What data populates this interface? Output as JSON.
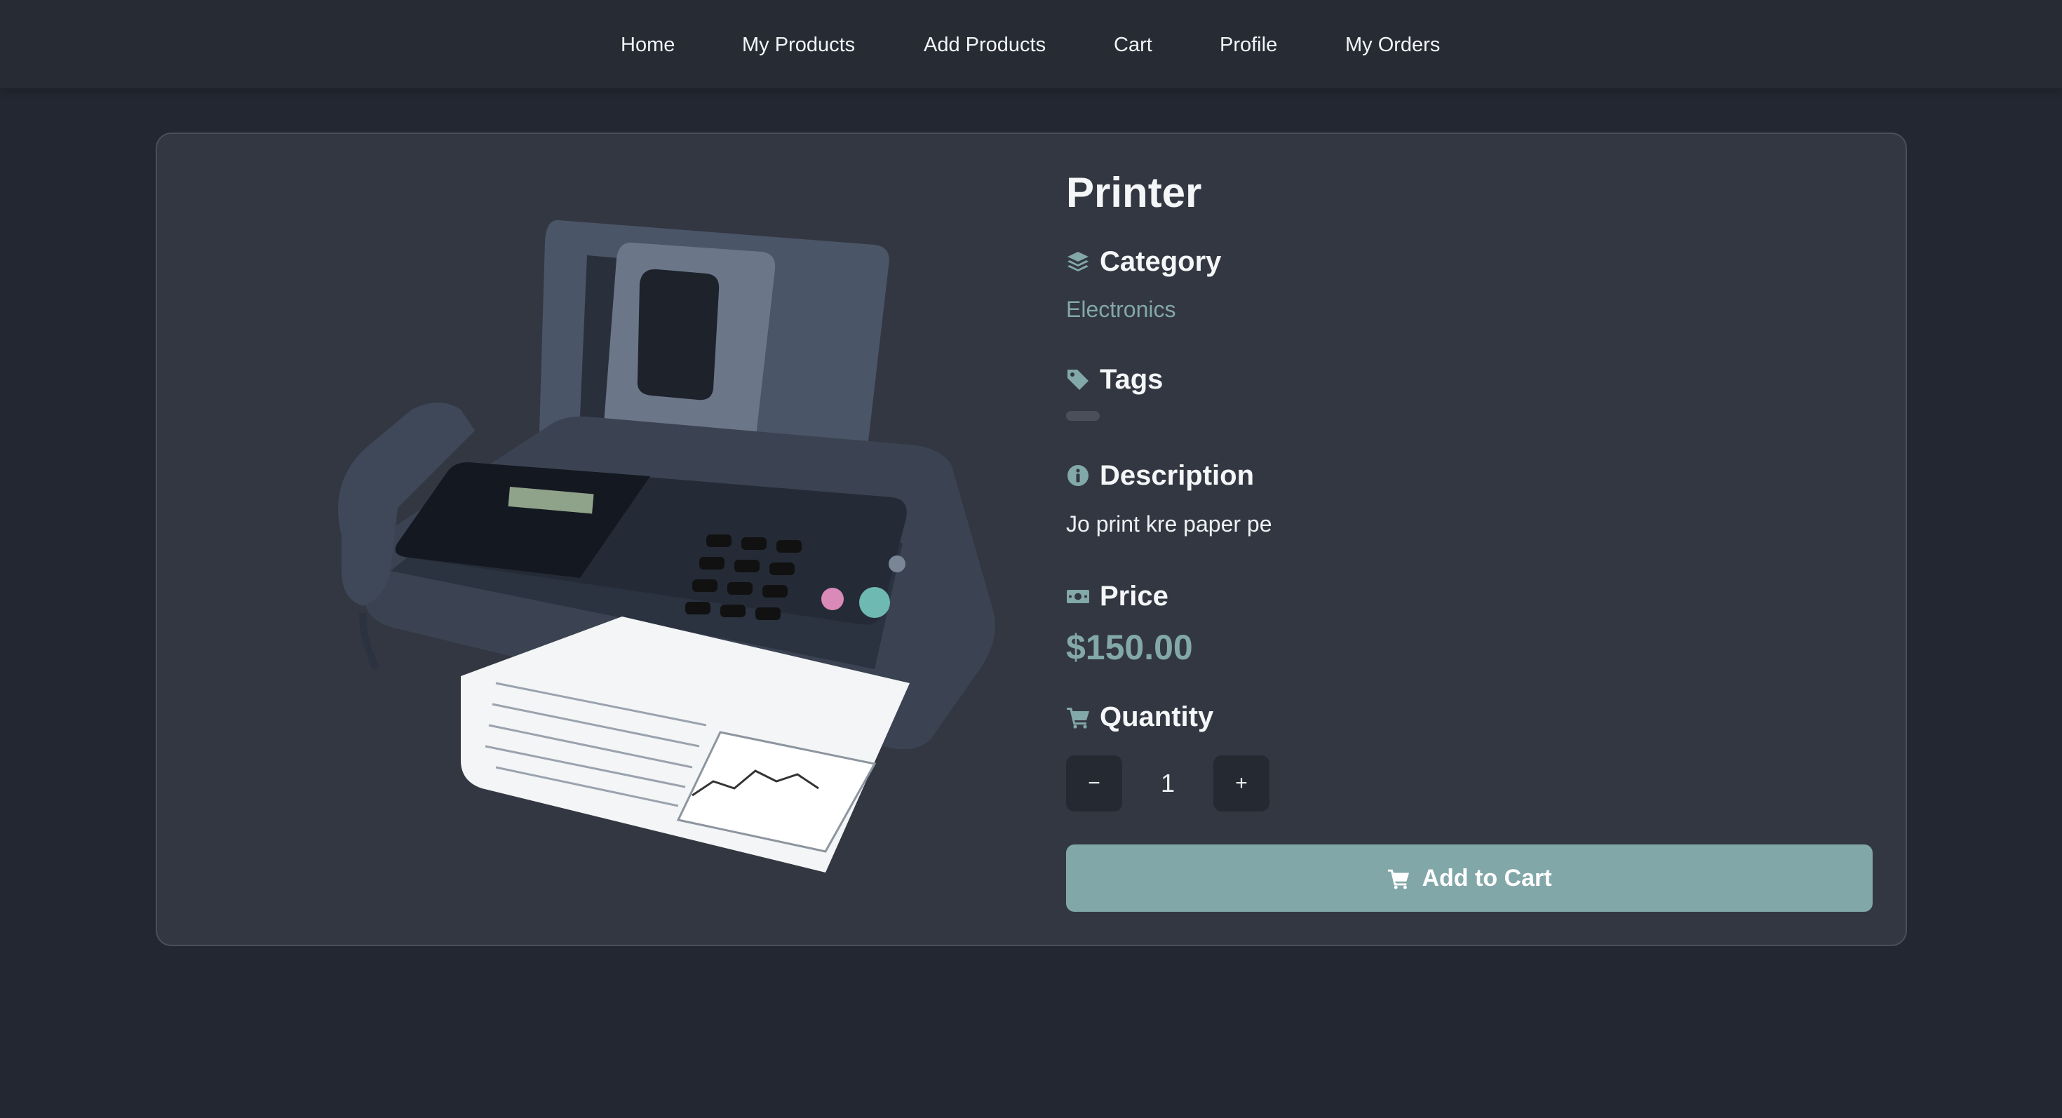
{
  "nav": {
    "items": [
      {
        "label": "Home"
      },
      {
        "label": "My Products"
      },
      {
        "label": "Add Products"
      },
      {
        "label": "Cart"
      },
      {
        "label": "Profile"
      },
      {
        "label": "My Orders"
      }
    ]
  },
  "product": {
    "title": "Printer",
    "image_icon": "fax-printer-image",
    "category": {
      "heading": "Category",
      "value": "Electronics",
      "icon": "layers-icon"
    },
    "tags": {
      "heading": "Tags",
      "icon": "tag-icon",
      "items": [
        ""
      ]
    },
    "description": {
      "heading": "Description",
      "value": "Jo print kre paper pe",
      "icon": "info-circle-icon"
    },
    "price": {
      "heading": "Price",
      "value": "$150.00",
      "icon": "money-bill-icon"
    },
    "quantity": {
      "heading": "Quantity",
      "icon": "cart-icon",
      "value": "1",
      "decrement_label": "−",
      "increment_label": "+"
    },
    "add_to_cart_label": "Add to Cart"
  },
  "colors": {
    "page_bg": "#232731",
    "nav_bg": "#272b34",
    "card_bg": "#333741",
    "accent": "#83a8a9",
    "button_bg": "#82a7a8",
    "qty_button_bg": "#252932"
  }
}
